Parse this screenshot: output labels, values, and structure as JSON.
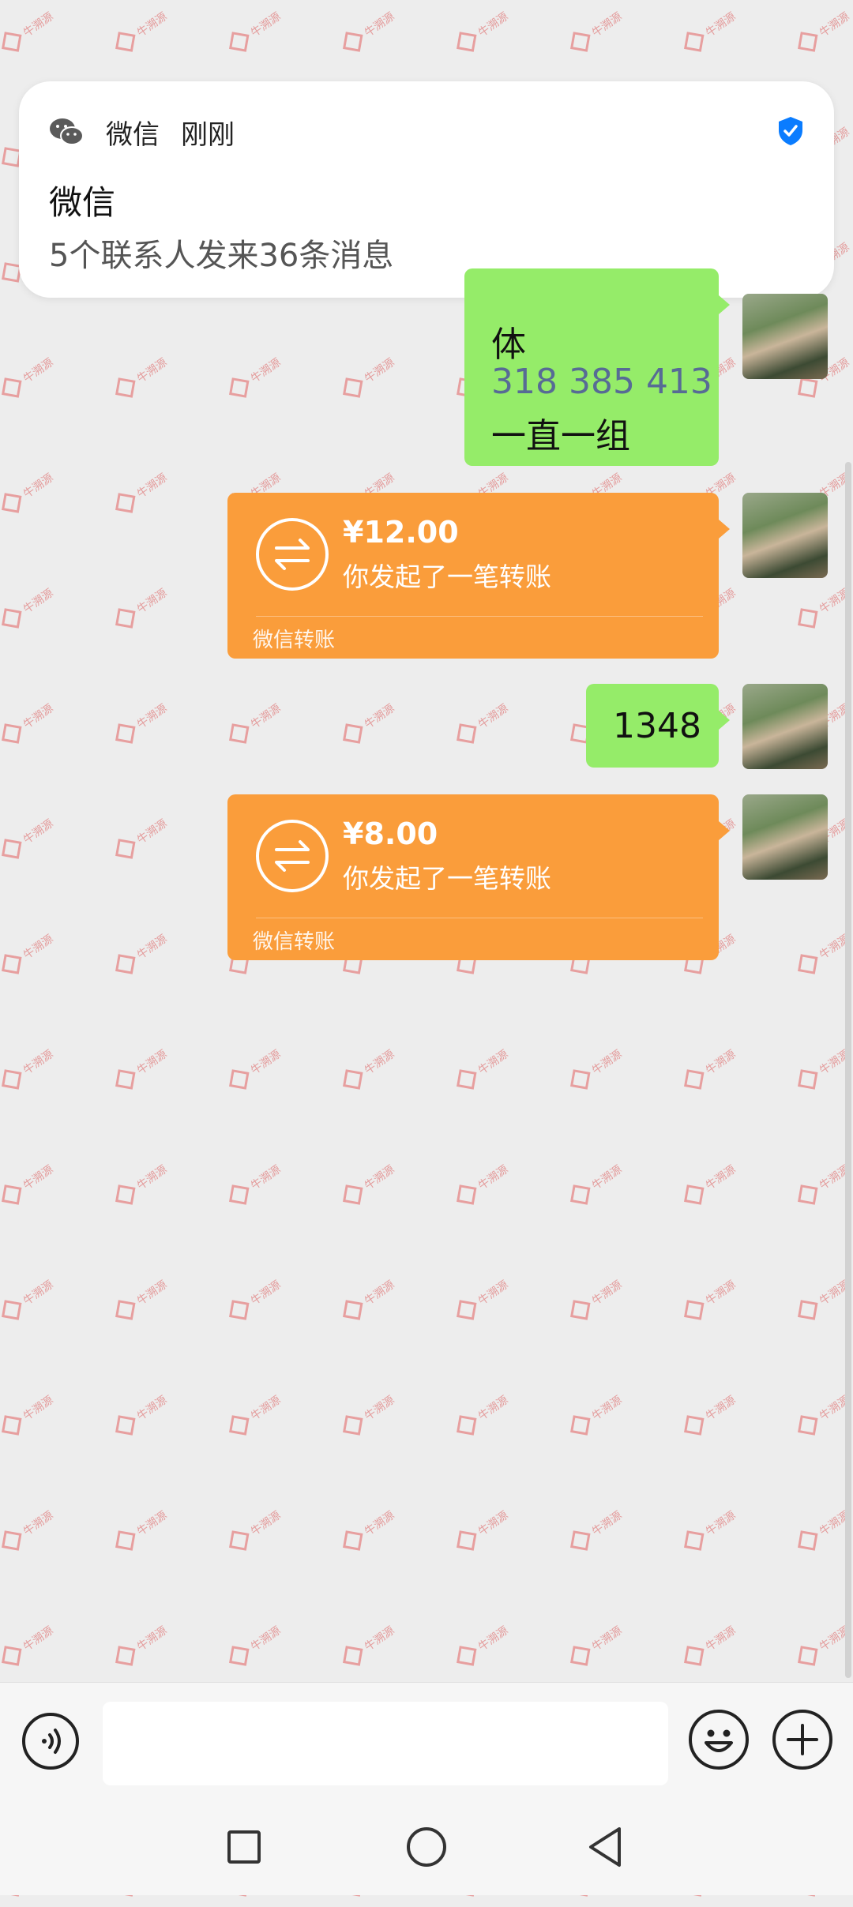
{
  "watermark": {
    "text": "牛溯源"
  },
  "notification": {
    "app_name": "微信",
    "time": "刚刚",
    "title": "微信",
    "body": "5个联系人发来36条消息"
  },
  "messages": [
    {
      "type": "text",
      "lines": [
        "体",
        "318 385 413",
        "一直一组"
      ]
    },
    {
      "type": "transfer",
      "amount": "¥12.00",
      "description": "你发起了一笔转账",
      "footer": "微信转账"
    },
    {
      "type": "text",
      "lines": [
        "1348"
      ]
    },
    {
      "type": "transfer",
      "amount": "¥8.00",
      "description": "你发起了一笔转账",
      "footer": "微信转账"
    }
  ],
  "input_bar": {
    "value": ""
  },
  "colors": {
    "bubble_green": "#95ec69",
    "transfer_orange": "#fa9d3b",
    "number_link_blue": "#576b95",
    "verified_blue": "#0a7cff"
  }
}
